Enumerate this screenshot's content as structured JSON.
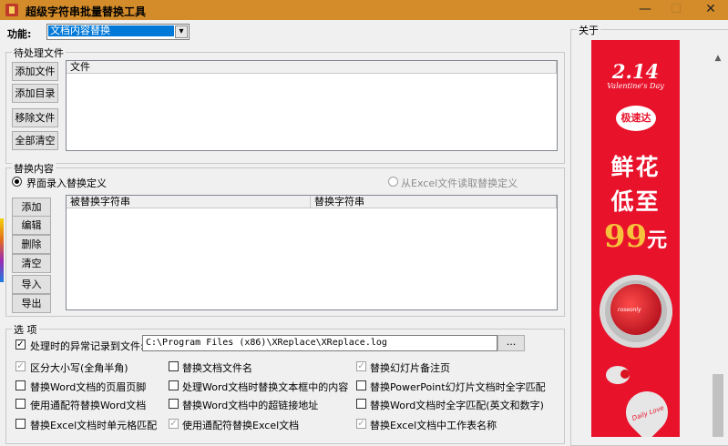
{
  "window": {
    "title": "超级字符串批量替换工具",
    "minimize": "—",
    "maximize": "☐",
    "close": "✕"
  },
  "function": {
    "label": "功能:",
    "selected": "文档内容替换",
    "arrow": "▾"
  },
  "files": {
    "group_title": "待处理文件",
    "buttons": [
      "添加文件",
      "添加目录",
      "移除文件",
      "全部清空"
    ],
    "column": "文件"
  },
  "replace": {
    "group_title": "替换内容",
    "radio_ui": "界面录入替换定义",
    "radio_excel": "从Excel文件读取替换定义",
    "buttons": [
      "添加",
      "编辑",
      "删除",
      "清空",
      "导入",
      "导出"
    ],
    "columns": [
      "被替换字符串",
      "替换字符串"
    ]
  },
  "options": {
    "group_title": "选  项",
    "log_label": "处理时的异常记录到文件:",
    "log_path": "C:\\Program Files (x86)\\XReplace\\XReplace.log",
    "browse": "...",
    "items": [
      {
        "label": "区分大小写(全角半角)",
        "checked": true,
        "disabled": true
      },
      {
        "label": "替换文档文件名",
        "checked": false,
        "disabled": false
      },
      {
        "label": "替换幻灯片备注页",
        "checked": true,
        "disabled": true
      },
      {
        "label": "替换Word文档的页眉页脚",
        "checked": false,
        "disabled": false
      },
      {
        "label": "处理Word文档时替换文本框中的内容",
        "checked": false,
        "disabled": false
      },
      {
        "label": "替换PowerPoint幻灯片文档时全字匹配",
        "checked": false,
        "disabled": false
      },
      {
        "label": "使用通配符替换Word文档",
        "checked": false,
        "disabled": false
      },
      {
        "label": "替换Word文档中的超链接地址",
        "checked": false,
        "disabled": false
      },
      {
        "label": "替换Word文档时全字匹配(英文和数字)",
        "checked": false,
        "disabled": false
      },
      {
        "label": "替换Excel文档时单元格匹配",
        "checked": false,
        "disabled": false
      },
      {
        "label": "使用通配符替换Excel文档",
        "checked": true,
        "disabled": true
      },
      {
        "label": "替换Excel文档中工作表名称",
        "checked": true,
        "disabled": true
      }
    ]
  },
  "about": {
    "group_title": "关于",
    "ad": {
      "headline": "2.14",
      "sub": "Valentine's Day",
      "badge": "极速达",
      "line1": "鲜花",
      "line2": "低至",
      "price": "99",
      "unit": "元",
      "box_text": "roseonly",
      "heart_text": "Daily Love",
      "colors": {
        "bg": "#e8122b",
        "price": "#f7c23c"
      }
    }
  }
}
